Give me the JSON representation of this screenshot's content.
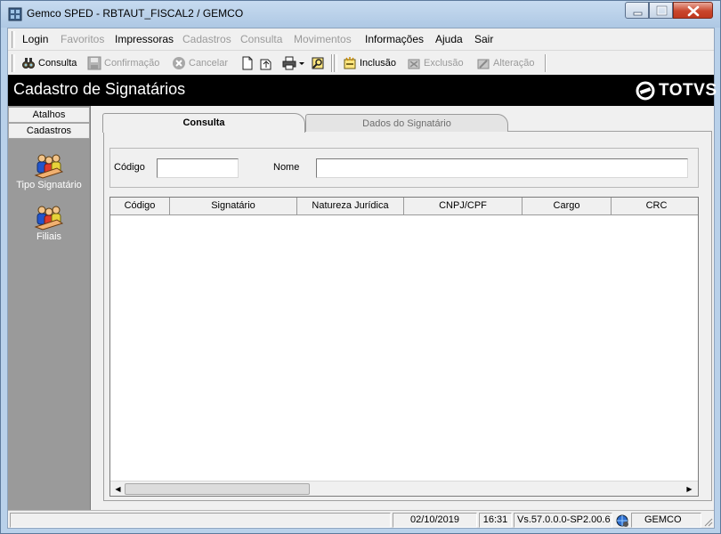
{
  "window": {
    "title": "Gemco SPED - RBTAUT_FISCAL2 / GEMCO"
  },
  "menu": [
    {
      "label": "Login",
      "enabled": true
    },
    {
      "label": "Favoritos",
      "enabled": false
    },
    {
      "label": "Impressoras",
      "enabled": true
    },
    {
      "label": "Cadastros",
      "enabled": false
    },
    {
      "label": "Consulta",
      "enabled": false
    },
    {
      "label": "Movimentos",
      "enabled": false
    },
    {
      "label": "Informações",
      "enabled": true
    },
    {
      "label": "Ajuda",
      "enabled": true
    },
    {
      "label": "Sair",
      "enabled": true
    }
  ],
  "toolbar": {
    "consulta": "Consulta",
    "confirmacao": "Confirmação",
    "cancelar": "Cancelar",
    "inclusao": "Inclusão",
    "exclusao": "Exclusão",
    "alteracao": "Alteração"
  },
  "header": {
    "title": "Cadastro de Signatários",
    "logo": "TOTVS"
  },
  "sidebar": {
    "tabs": [
      "Atalhos",
      "Cadastros"
    ],
    "items": [
      "Tipo Signatário",
      "Filiais"
    ]
  },
  "tabs": {
    "active": "Consulta",
    "inactive": "Dados do Signatário"
  },
  "filters": {
    "codigo_label": "Código",
    "codigo_value": "",
    "nome_label": "Nome",
    "nome_value": ""
  },
  "grid": {
    "columns": [
      "Código",
      "Signatário",
      "Natureza Jurídica",
      "CNPJ/CPF",
      "Cargo",
      "CRC"
    ],
    "rows": []
  },
  "status": {
    "date": "02/10/2019",
    "time": "16:31",
    "version": "Vs.57.0.0.0-SP2.00.6",
    "company": "GEMCO"
  },
  "colors": {
    "header_bg": "#000000",
    "sidebar_bg": "#9a9a9a",
    "window_frame": "#b9d1ea"
  }
}
